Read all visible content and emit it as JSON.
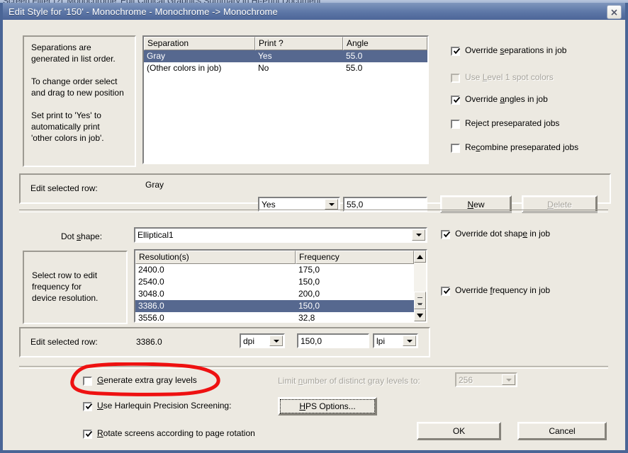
{
  "background_window": {
    "ghost_title": "Screen Filter [?] 'Monochrome' Edit Clinical Graphics Summary in Hi-Print Document"
  },
  "window": {
    "title": "Edit Style for '150' - Monochrome - Monochrome -> Monochrome",
    "close_icon": "close-icon",
    "titlebar_color": "#5c76a6",
    "face_color": "#ece9e1",
    "selection_color": "#56688f"
  },
  "separations_section": {
    "help_text": [
      "Separations are",
      "generated in list order.",
      "",
      "To change order select",
      "and drag to new position",
      "",
      "Set print to 'Yes' to",
      "automatically print",
      "'other colors in job'."
    ],
    "table": {
      "columns": [
        "Separation",
        "Print ?",
        "Angle"
      ],
      "rows": [
        {
          "separation": "Gray",
          "print": "Yes",
          "angle": "55.0",
          "selected": true
        },
        {
          "separation": "(Other colors in job)",
          "print": "No",
          "angle": "55.0",
          "selected": false
        }
      ]
    },
    "checkboxes": [
      {
        "label_pre": "Override ",
        "label_key": "s",
        "label_post": "eparations in job",
        "checked": true,
        "enabled": true
      },
      {
        "label_pre": "Use ",
        "label_key": "L",
        "label_post": "evel 1 spot colors",
        "checked": false,
        "enabled": false
      },
      {
        "label_pre": "Override ",
        "label_key": "a",
        "label_post": "ngles in job",
        "checked": true,
        "enabled": true
      },
      {
        "label_pre": "Re",
        "label_key": "j",
        "label_post": "ect preseparated jobs",
        "checked": false,
        "enabled": true
      },
      {
        "label_pre": "Re",
        "label_key": "c",
        "label_post": "ombine preseparated jobs",
        "checked": false,
        "enabled": true
      }
    ],
    "edit_row": {
      "label": "Edit selected row:",
      "selected_name": "Gray",
      "print_value": "Yes",
      "angle_value": "55,0",
      "new_button_pre": "",
      "new_button_key": "N",
      "new_button_post": "ew",
      "delete_button_pre": "",
      "delete_button_key": "D",
      "delete_button_post": "elete",
      "delete_enabled": false
    }
  },
  "screening_section": {
    "dot_shape_label_pre": "Dot ",
    "dot_shape_label_key": "s",
    "dot_shape_label_post": "hape:",
    "dot_shape_value": "Elliptical1",
    "help_text": [
      "Select row to edit",
      "frequency for",
      "device resolution."
    ],
    "table": {
      "columns": [
        "Resolution(s)",
        "Frequency"
      ],
      "rows": [
        {
          "resolution": "2400.0",
          "frequency": "175,0",
          "selected": false
        },
        {
          "resolution": "2540.0",
          "frequency": "150,0",
          "selected": false
        },
        {
          "resolution": "3048.0",
          "frequency": "200,0",
          "selected": false
        },
        {
          "resolution": "3386.0",
          "frequency": "150,0",
          "selected": true
        },
        {
          "resolution": "3556.0",
          "frequency": "32,8",
          "selected": false
        }
      ]
    },
    "checkboxes": [
      {
        "label_pre": "Override dot shap",
        "label_key": "e",
        "label_post": " in job",
        "checked": true,
        "enabled": true
      },
      {
        "label_pre": "Override ",
        "label_key": "f",
        "label_post": "requency in job",
        "checked": true,
        "enabled": true
      }
    ],
    "edit_row": {
      "label": "Edit selected row:",
      "selected_resolution": "3386.0",
      "resolution_unit": "dpi",
      "frequency_value": "150,0",
      "frequency_unit": "lpi"
    }
  },
  "gray_section": {
    "generate_extra": {
      "label_pre": "",
      "label_key": "G",
      "label_post": "enerate extra gray levels",
      "checked": false,
      "enabled": true
    },
    "limit_label_pre": "Limit ",
    "limit_label_key": "n",
    "limit_label_post": "umber of distinct gray levels to:",
    "limit_value": "256",
    "limit_enabled": false,
    "hps_checkbox": {
      "label_pre": "",
      "label_key": "U",
      "label_post": "se Harlequin Precision Screening:",
      "checked": true,
      "enabled": true
    },
    "hps_button_pre": "",
    "hps_button_key": "H",
    "hps_button_post": "PS Options...",
    "rotate_checkbox": {
      "label_pre": "",
      "label_key": "R",
      "label_post": "otate screens according to page rotation",
      "checked": true,
      "enabled": true
    }
  },
  "footer": {
    "ok_label": "OK",
    "cancel_label": "Cancel"
  },
  "annotation": {
    "shape": "red-ellipse-highlight",
    "color": "#ee1111",
    "target": "Generate extra gray levels"
  }
}
